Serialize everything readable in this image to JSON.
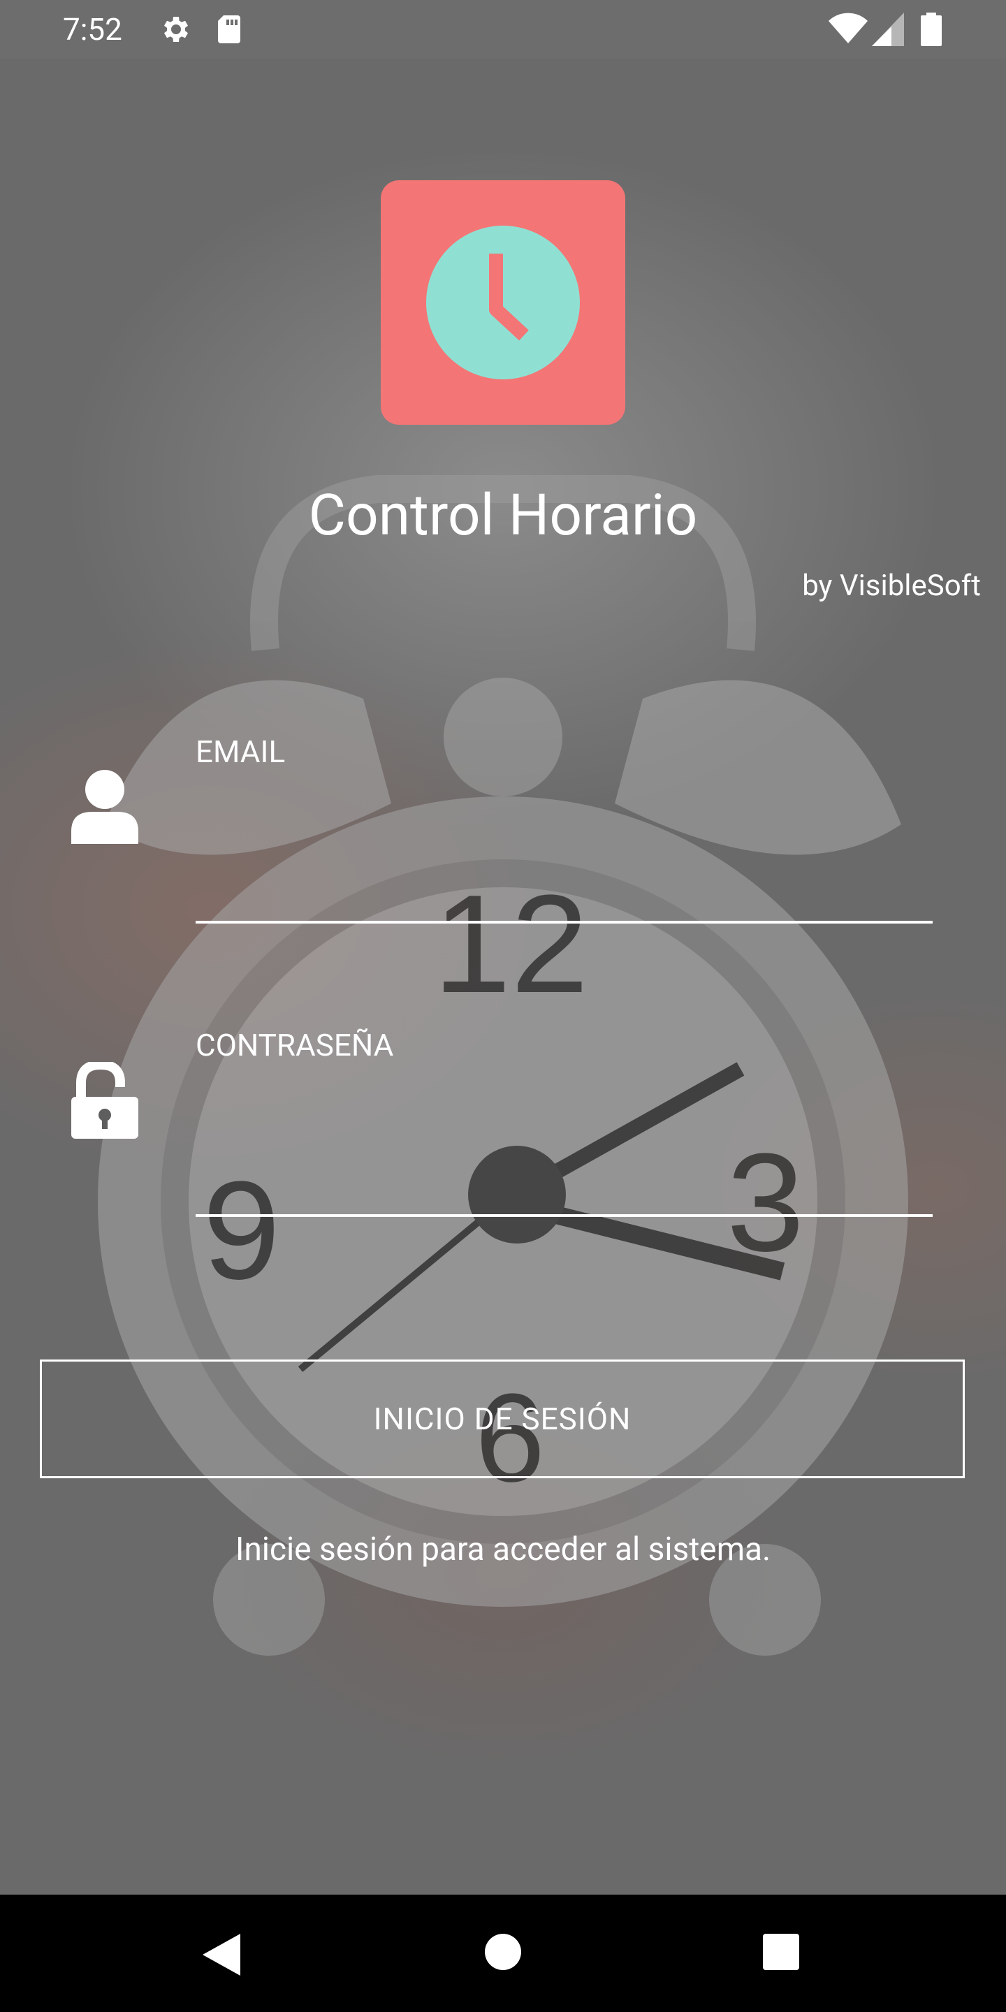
{
  "status_bar": {
    "time": "7:52",
    "icons": [
      "settings-icon",
      "sd-card-icon",
      "wifi-icon",
      "cellular-signal-icon",
      "battery-icon"
    ]
  },
  "app": {
    "icon": "clock-icon",
    "icon_bg_color": "#f47575",
    "icon_face_color": "#8fe0d3",
    "title": "Control Horario",
    "byline": "by VisibleSoft"
  },
  "form": {
    "email": {
      "label": "EMAIL",
      "icon": "person-icon",
      "value": ""
    },
    "password": {
      "label": "CONTRASEÑA",
      "icon": "unlock-icon",
      "value": ""
    },
    "login_button": "INICIO DE SESIÓN",
    "info": "Inicie sesión para acceder al sistema."
  },
  "nav_bar": {
    "buttons": [
      "back-icon",
      "home-icon",
      "recents-icon"
    ]
  }
}
